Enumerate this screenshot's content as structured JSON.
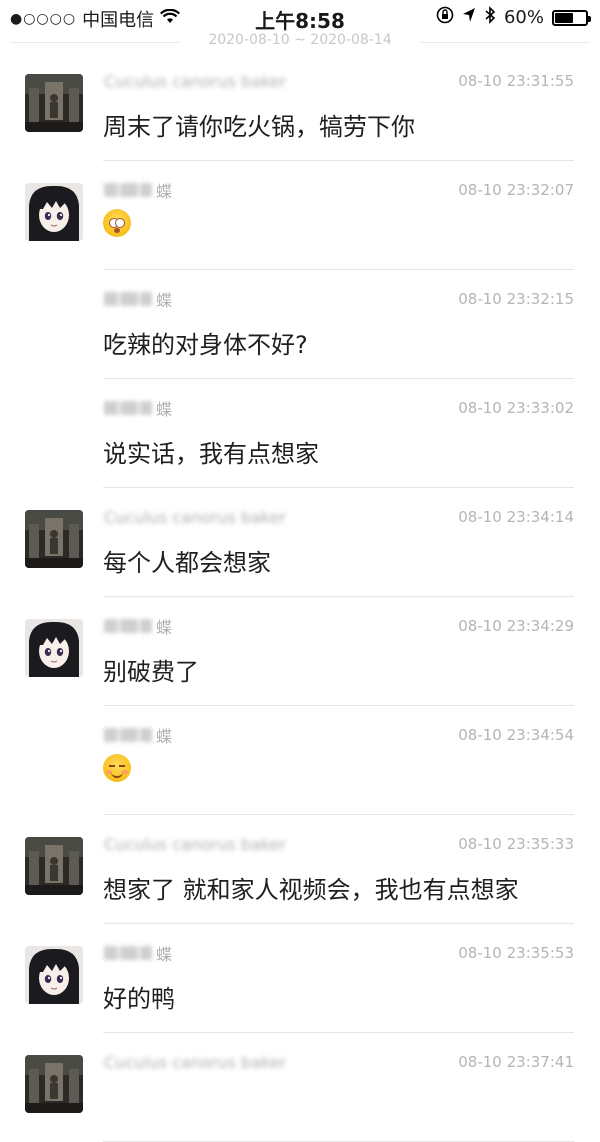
{
  "status_bar": {
    "signal_dots": "●○○○○",
    "carrier": "中国电信",
    "wifi_icon": "wifi-icon",
    "time": "上午8:58",
    "lock_icon": "orientation-lock-icon",
    "location_icon": "location-arrow-icon",
    "bluetooth_icon": "bluetooth-icon",
    "battery_text": "60%",
    "battery_level": 0.6
  },
  "date_range": "2020-08-10 ~ 2020-08-14",
  "messages": [
    {
      "sender": "Cuculus canorus baker",
      "avatar": "photo",
      "time": "08-10 23:31:55",
      "text": "周末了请你吃火锅，犒劳下你",
      "emoji": null
    },
    {
      "sender": "蝶",
      "avatar": "anime",
      "time": "08-10 23:32:07",
      "text": "",
      "emoji": "flushed"
    },
    {
      "sender": "蝶",
      "avatar": null,
      "time": "08-10 23:32:15",
      "text": "吃辣的对身体不好?",
      "emoji": null
    },
    {
      "sender": "蝶",
      "avatar": null,
      "time": "08-10 23:33:02",
      "text": "说实话，我有点想家",
      "emoji": null
    },
    {
      "sender": "Cuculus canorus baker",
      "avatar": "photo",
      "time": "08-10 23:34:14",
      "text": "每个人都会想家",
      "emoji": null
    },
    {
      "sender": "蝶",
      "avatar": "anime",
      "time": "08-10 23:34:29",
      "text": "别破费了",
      "emoji": null
    },
    {
      "sender": "蝶",
      "avatar": null,
      "time": "08-10 23:34:54",
      "text": "",
      "emoji": "smile"
    },
    {
      "sender": "Cuculus canorus baker",
      "avatar": "photo",
      "time": "08-10 23:35:33",
      "text": "想家了 就和家人视频会，我也有点想家",
      "emoji": null
    },
    {
      "sender": "蝶",
      "avatar": "anime",
      "time": "08-10 23:35:53",
      "text": "好的鸭",
      "emoji": null
    },
    {
      "sender": "Cuculus canorus baker",
      "avatar": "photo",
      "time": "08-10 23:37:41",
      "text": "",
      "emoji": null
    }
  ]
}
